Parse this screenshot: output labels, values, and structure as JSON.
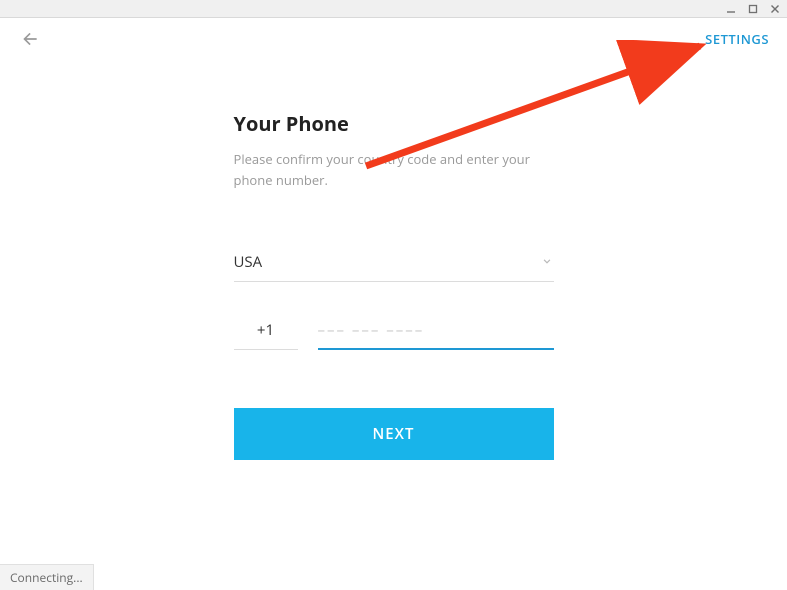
{
  "window": {
    "minimize_label": "minimize",
    "maximize_label": "maximize",
    "close_label": "close"
  },
  "header": {
    "settings_label": "SETTINGS"
  },
  "main": {
    "title": "Your Phone",
    "subtitle": "Please confirm your country code and enter your phone number.",
    "country_selected": "USA",
    "dial_code": "+1",
    "phone_value": "",
    "phone_placeholder": "––– ––– ––––"
  },
  "actions": {
    "next_label": "NEXT"
  },
  "status": {
    "text": "Connecting..."
  },
  "colors": {
    "accent": "#1e98d4",
    "primary_button": "#18b4ea",
    "annotation": "#f23b1c"
  }
}
